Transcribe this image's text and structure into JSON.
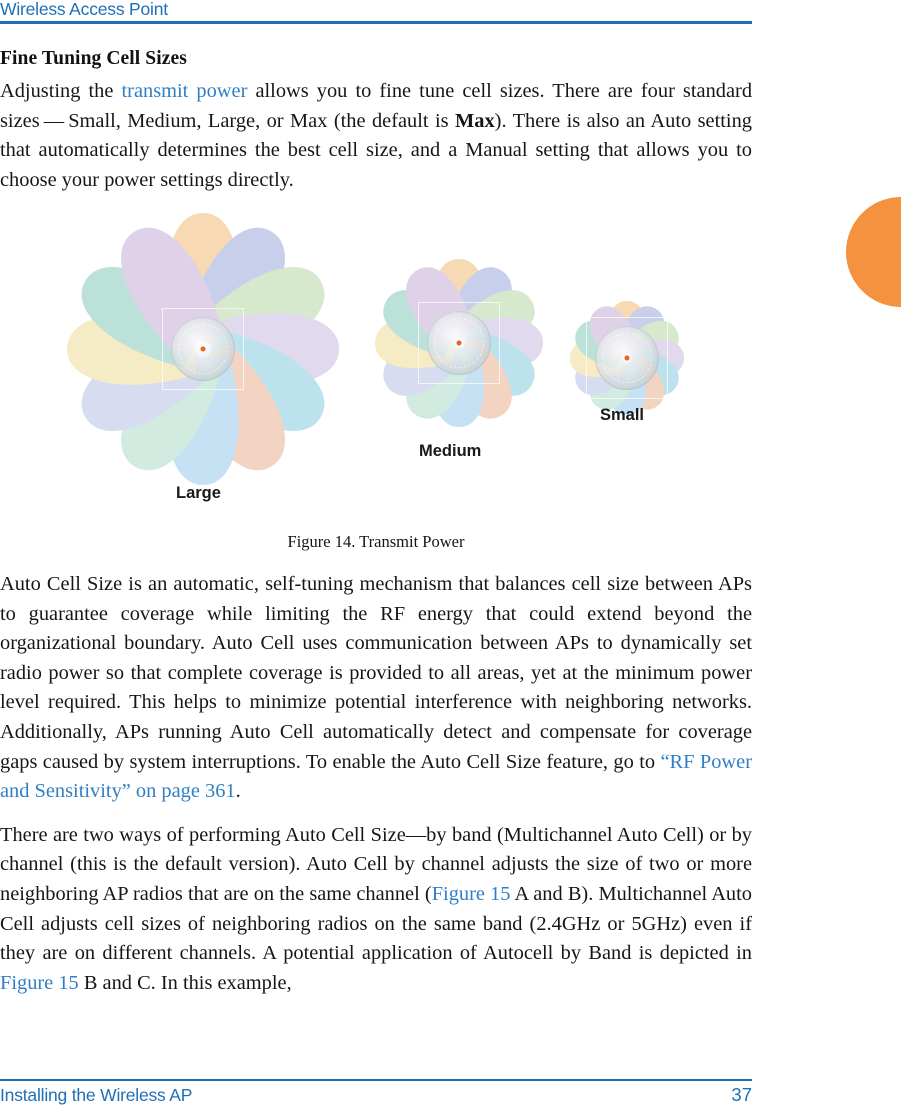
{
  "header": {
    "running_title": "Wireless Access Point",
    "rule_color": "#1f6fb5"
  },
  "section": {
    "heading": "Fine Tuning Cell Sizes",
    "paragraph_1": {
      "part_1": "Adjusting the ",
      "link_1": "transmit power",
      "part_2": " allows you to fine tune cell sizes. There are four standard sizes — Small, Medium, Large, or Max (the default is ",
      "bold_1": "Max",
      "part_3": "). There is also an Auto setting that automatically determines the best cell size, and a Manual setting that allows you to choose your power settings directly."
    },
    "paragraph_2": {
      "part_1": "Auto Cell Size is an automatic, self-tuning mechanism that balances cell size between APs to guarantee coverage while limiting the RF energy that could extend beyond the organizational boundary. Auto Cell uses communication between APs to dynamically set radio power so that complete coverage is provided to all areas, yet at the minimum power level required. This helps to minimize potential interference with neighboring networks. Additionally, APs running Auto Cell automatically detect and compensate for coverage gaps caused by system interruptions. To enable the Auto Cell Size feature, go to ",
      "link_1": "“RF Power and Sensitivity” on page 361",
      "part_2": "."
    },
    "paragraph_3": {
      "part_1": "There are two ways of performing Auto Cell Size—by band (Multichannel Auto Cell) or by channel (this is the default version).  Auto Cell by channel  adjusts the size of two or more neighboring AP radios that are on the same channel (",
      "link_1": "Figure 15",
      "part_2": " A and B). Multichannel Auto Cell adjusts cell sizes of  neighboring radios on the same band  (2.4GHz or 5GHz) even if they are on different channels. A potential application of Autocell by Band is depicted in ",
      "link_2": "Figure 15",
      "part_3": " B and C. In this example,"
    }
  },
  "figure": {
    "caption": "Figure 14. Transmit Power",
    "cells": [
      {
        "label": "Large",
        "name": "large-cell"
      },
      {
        "label": "Medium",
        "name": "medium-cell"
      },
      {
        "label": "Small",
        "name": "small-cell"
      }
    ],
    "petal_colors": [
      "#f6cfa0",
      "#b9c2e6",
      "#cde3c0",
      "#d9cfe8",
      "#a9dbe8",
      "#f0c9b2",
      "#b8d9f2",
      "#c6e6d8",
      "#cdd3ee",
      "#f3e6b4",
      "#a8d9cf",
      "#d7c6e2"
    ],
    "hub_center_color": "#e8622a"
  },
  "edge_tab": {
    "color": "#f4923f"
  },
  "footer": {
    "left": "Installing the Wireless AP",
    "page_number": "37",
    "rule_color": "#1f6fb5"
  }
}
